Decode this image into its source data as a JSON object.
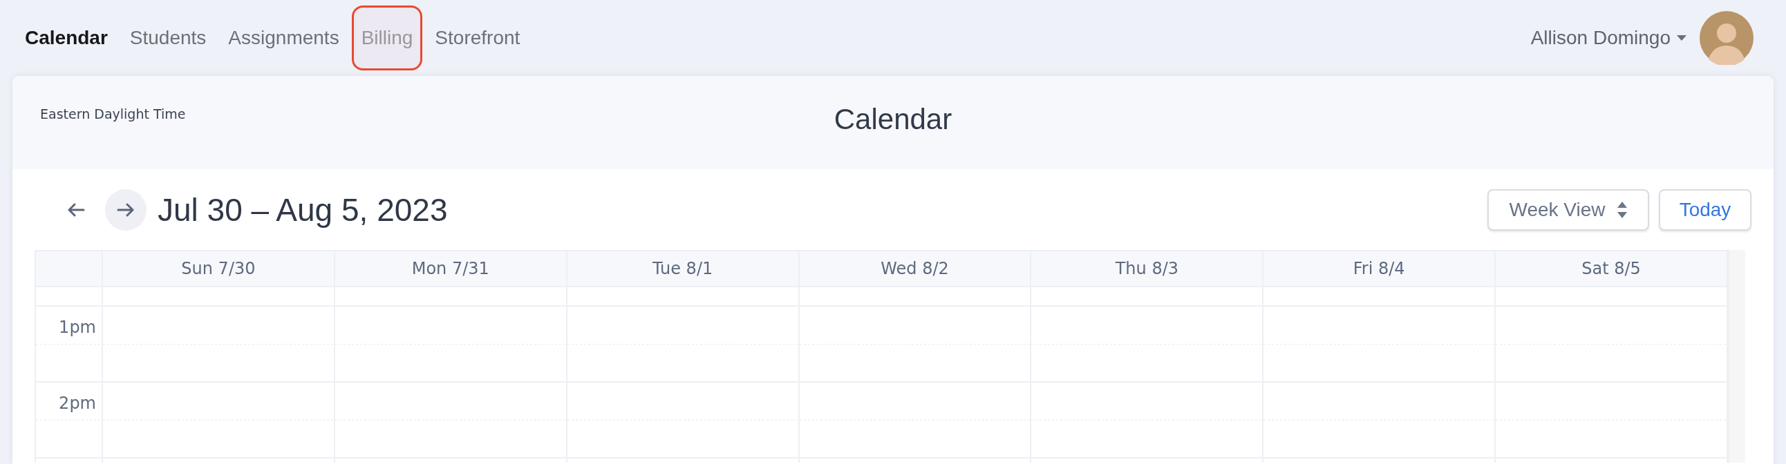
{
  "nav": {
    "items": [
      {
        "label": "Calendar",
        "selected": true,
        "highlighted": false
      },
      {
        "label": "Students",
        "selected": false,
        "highlighted": false
      },
      {
        "label": "Assignments",
        "selected": false,
        "highlighted": false
      },
      {
        "label": "Billing",
        "selected": false,
        "highlighted": true
      },
      {
        "label": "Storefront",
        "selected": false,
        "highlighted": false
      }
    ],
    "user": {
      "name": "Allison Domingo"
    }
  },
  "header": {
    "timezone": "Eastern Daylight Time",
    "title": "Calendar"
  },
  "toolbar": {
    "range": "Jul 30 – Aug 5, 2023",
    "view_select": {
      "value": "Week View"
    },
    "today_button": "Today"
  },
  "calendar": {
    "columns": [
      "Sun 7/30",
      "Mon 7/31",
      "Tue 8/1",
      "Wed 8/2",
      "Thu 8/3",
      "Fri 8/4",
      "Sat 8/5"
    ],
    "time_slots": [
      "1pm",
      "2pm"
    ]
  }
}
